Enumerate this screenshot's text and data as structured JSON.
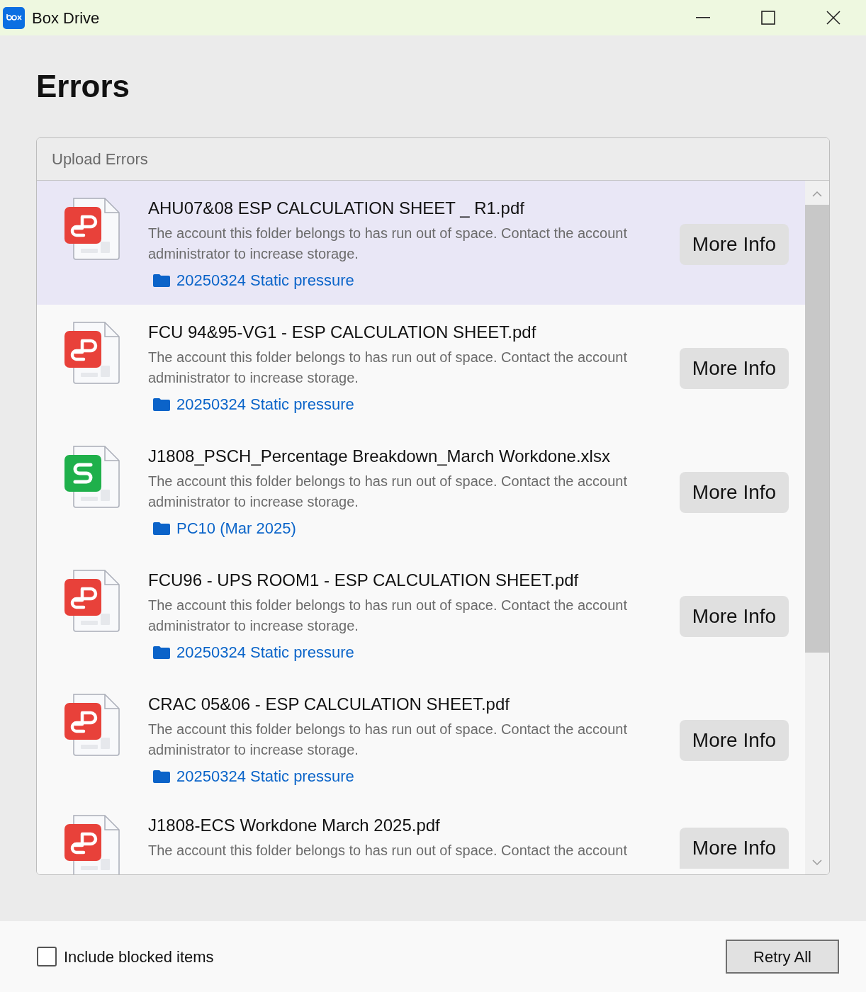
{
  "window": {
    "title": "Box Drive"
  },
  "heading": "Errors",
  "panel": {
    "title": "Upload Errors",
    "items": [
      {
        "kind": "pdf",
        "selected": true,
        "name": "AHU07&08 ESP CALCULATION SHEET _ R1.pdf",
        "message": "The account this folder belongs to has run out of space. Contact the account administrator to increase storage.",
        "folder": "20250324 Static pressure",
        "button": "More Info"
      },
      {
        "kind": "pdf",
        "selected": false,
        "name": "FCU 94&95-VG1 - ESP CALCULATION SHEET.pdf",
        "message": "The account this folder belongs to has run out of space. Contact the account administrator to increase storage.",
        "folder": "20250324 Static pressure",
        "button": "More Info"
      },
      {
        "kind": "xlsx",
        "selected": false,
        "name": "J1808_PSCH_Percentage Breakdown_March Workdone.xlsx",
        "message": "The account this folder belongs to has run out of space. Contact the account administrator to increase storage.",
        "folder": "PC10 (Mar 2025)",
        "button": "More Info"
      },
      {
        "kind": "pdf",
        "selected": false,
        "name": "FCU96 - UPS ROOM1 - ESP CALCULATION SHEET.pdf",
        "message": "The account this folder belongs to has run out of space. Contact the account administrator to increase storage.",
        "folder": "20250324 Static pressure",
        "button": "More Info"
      },
      {
        "kind": "pdf",
        "selected": false,
        "name": "CRAC 05&06 - ESP CALCULATION SHEET.pdf",
        "message": "The account this folder belongs to has run out of space. Contact the account administrator to increase storage.",
        "folder": "20250324 Static pressure",
        "button": "More Info"
      },
      {
        "kind": "pdf",
        "selected": false,
        "name": "J1808-ECS Workdone March 2025.pdf",
        "message": "The account this folder belongs to has run out of space. Contact the account",
        "button": "More Info"
      }
    ]
  },
  "footer": {
    "checkbox": {
      "label": "Include blocked items",
      "checked": false
    },
    "button": "Retry All"
  }
}
